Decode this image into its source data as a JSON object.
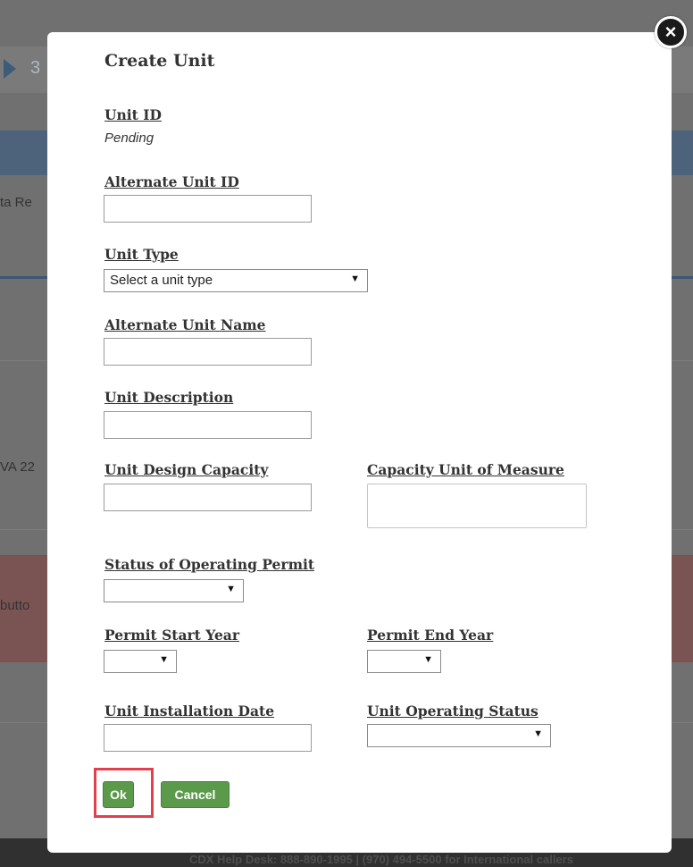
{
  "background": {
    "breadcrumb_step": "3",
    "side_text_1": "ta Re",
    "side_text_2": "VA 22",
    "side_text_3": "butto",
    "footer_text": "CDX Help Desk: 888-890-1995 | (970) 494-5500 for International callers"
  },
  "modal": {
    "title": "Create Unit",
    "close_icon": "×",
    "unit_id": {
      "label": "Unit ID",
      "value": "Pending"
    },
    "alternate_unit_id": {
      "label": "Alternate Unit ID",
      "value": ""
    },
    "unit_type": {
      "label": "Unit Type",
      "selected": "Select a unit type"
    },
    "alternate_unit_name": {
      "label": "Alternate Unit Name",
      "value": ""
    },
    "unit_description": {
      "label": "Unit Description",
      "value": ""
    },
    "unit_design_capacity": {
      "label": "Unit Design Capacity",
      "value": ""
    },
    "capacity_unit_of_measure": {
      "label": "Capacity Unit of Measure",
      "value": ""
    },
    "status_of_operating_permit": {
      "label": "Status of Operating Permit",
      "selected": ""
    },
    "permit_start_year": {
      "label": "Permit Start Year",
      "selected": ""
    },
    "permit_end_year": {
      "label": "Permit End Year",
      "selected": ""
    },
    "unit_installation_date": {
      "label": "Unit Installation Date",
      "value": ""
    },
    "unit_operating_status": {
      "label": "Unit Operating Status",
      "selected": ""
    },
    "ok_label": "Ok",
    "cancel_label": "Cancel",
    "caret": "▼"
  },
  "colors": {
    "button_green": "#5c9a4b",
    "highlight_red": "#e0414c",
    "overlay_gray": "#707070"
  }
}
